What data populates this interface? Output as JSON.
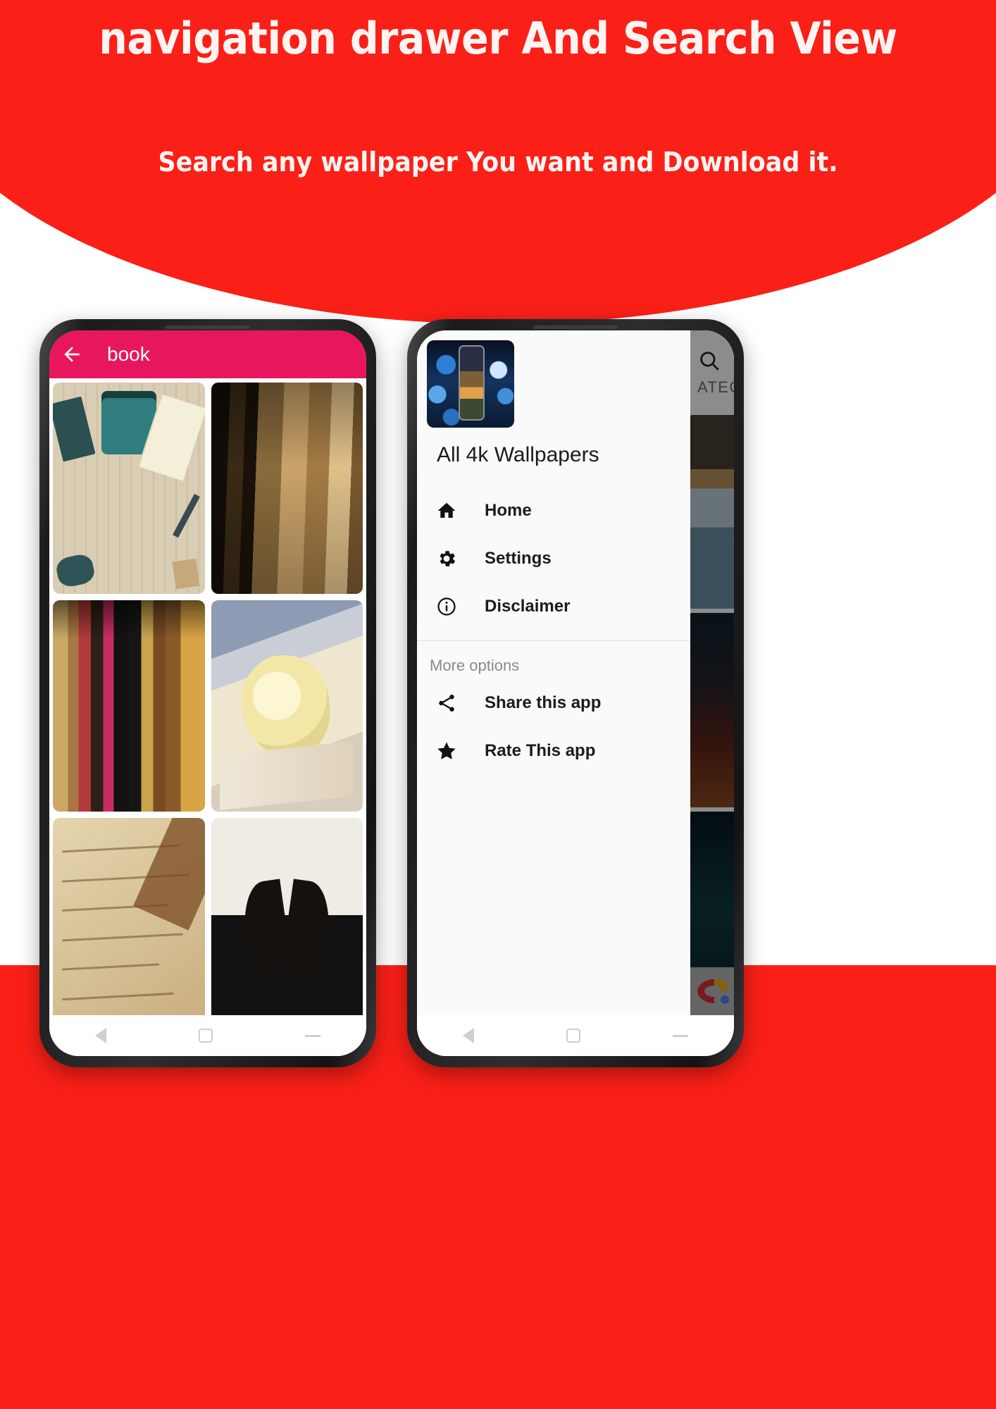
{
  "banner": {
    "title": "navigation drawer And Search View",
    "subtitle": "Search any wallpaper You want and Download it.",
    "bg_color": "#FA2017",
    "text_color": "#FFF4F2"
  },
  "left_phone": {
    "appbar": {
      "back_icon": "arrow-left-icon",
      "title": "book",
      "bg_color": "#E8175D",
      "text_color": "#FFFFFF"
    },
    "grid": {
      "columns": 2,
      "tiles": [
        {
          "alt": "vintage typewriter and notebook on wooden desk"
        },
        {
          "alt": "stack of old worn books"
        },
        {
          "alt": "row of antique book spines on a shelf"
        },
        {
          "alt": "open book with yellow rose"
        },
        {
          "alt": "old handwritten manuscript page"
        },
        {
          "alt": "book pages folded into a heart shape"
        }
      ]
    },
    "navbar": {
      "back": "nav-back-icon",
      "home": "nav-home-icon",
      "recents": "nav-recents-icon"
    }
  },
  "right_phone": {
    "background": {
      "tab_label": "ATEGORY",
      "search_icon": "search-icon",
      "thumbnails": [
        {
          "alt": "cracked blue ice lake at sunset"
        },
        {
          "alt": "red sunset over snowy mountain"
        },
        {
          "alt": "dark teal aurora sky"
        }
      ],
      "ad_banner": "admob-logo"
    },
    "drawer": {
      "logo_icon": "app-logo-icon",
      "logo_alt": "phone with bokeh wallpaper app icon",
      "app_name": "All 4k Wallpapers",
      "items": [
        {
          "icon": "home-icon",
          "label": "Home"
        },
        {
          "icon": "gear-icon",
          "label": "Settings"
        },
        {
          "icon": "info-circle-icon",
          "label": "Disclaimer"
        }
      ],
      "section_title": "More options",
      "more_items": [
        {
          "icon": "share-icon",
          "label": "Share this app"
        },
        {
          "icon": "star-icon",
          "label": "Rate This app"
        }
      ]
    },
    "navbar": {
      "back": "nav-back-icon",
      "home": "nav-home-icon",
      "recents": "nav-recents-icon"
    }
  }
}
